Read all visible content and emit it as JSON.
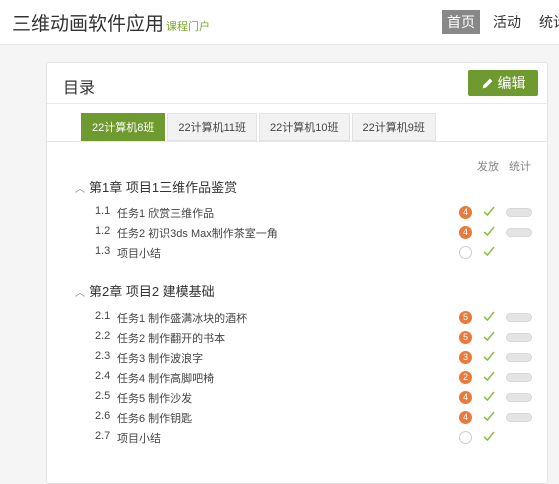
{
  "app": {
    "title": "三维动画软件应用",
    "subtitle": "课程门户"
  },
  "nav": [
    {
      "label": "首页",
      "active": true
    },
    {
      "label": "活动"
    },
    {
      "label": "统计"
    }
  ],
  "card": {
    "title": "目录",
    "edit_label": "编辑"
  },
  "tabs": [
    {
      "label": "22计算机8班",
      "active": true
    },
    {
      "label": "22计算机11班"
    },
    {
      "label": "22计算机10班"
    },
    {
      "label": "22计算机9班"
    }
  ],
  "columns": {
    "publish": "发放",
    "stats": "统计"
  },
  "chapters": [
    {
      "title": "第1章 项目1三维作品鉴赏",
      "items": [
        {
          "num": "1.1",
          "label": "任务1 欣赏三维作品",
          "badge": "4"
        },
        {
          "num": "1.2",
          "label": "任务2 初识3ds Max制作茶室一角",
          "badge": "4"
        },
        {
          "num": "1.3",
          "label": "项目小结",
          "badge": ""
        }
      ]
    },
    {
      "title": "第2章 项目2 建模基础",
      "items": [
        {
          "num": "2.1",
          "label": "任务1 制作盛满冰块的酒杯",
          "badge": "5"
        },
        {
          "num": "2.2",
          "label": "任务2 制作翻开的书本",
          "badge": "5"
        },
        {
          "num": "2.3",
          "label": "任务3 制作波浪字",
          "badge": "3"
        },
        {
          "num": "2.4",
          "label": "任务4 制作高脚吧椅",
          "badge": "2"
        },
        {
          "num": "2.5",
          "label": "任务5 制作沙发",
          "badge": "4"
        },
        {
          "num": "2.6",
          "label": "任务6 制作钥匙",
          "badge": "4"
        },
        {
          "num": "2.7",
          "label": "项目小结",
          "badge": ""
        }
      ]
    }
  ],
  "colors": {
    "accent": "#6e9a2f",
    "badge": "#ea7a3b",
    "check": "#8bbf3f"
  }
}
